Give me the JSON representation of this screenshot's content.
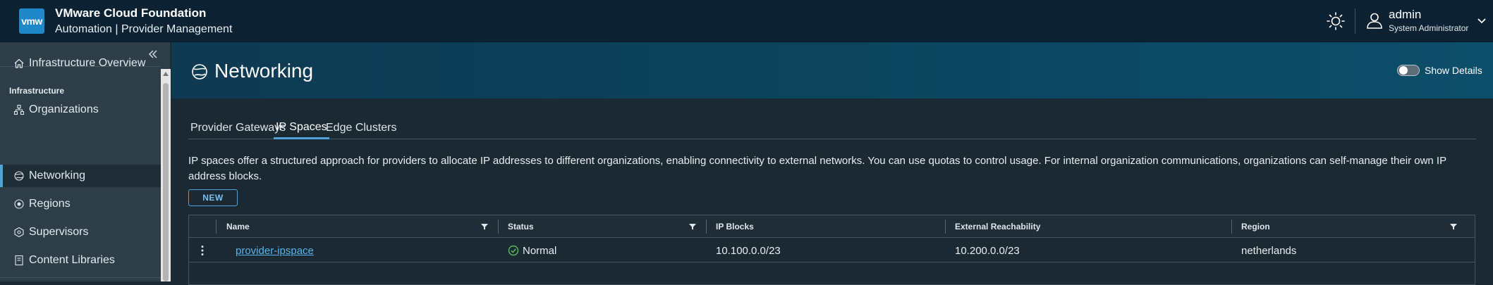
{
  "header": {
    "logo_text": "vmw",
    "app_title": "VMware Cloud Foundation",
    "app_subtitle": "Automation | Provider Management",
    "user_name": "admin",
    "user_role": "System Administrator"
  },
  "sidebar": {
    "items": [
      {
        "label": "Infrastructure Overview",
        "icon": "home-icon"
      },
      {
        "label": "Organizations",
        "icon": "organizations-icon"
      },
      {
        "label": "Networking",
        "icon": "networking-icon",
        "active": true
      },
      {
        "label": "Regions",
        "icon": "regions-icon"
      },
      {
        "label": "Supervisors",
        "icon": "supervisors-icon"
      },
      {
        "label": "Content Libraries",
        "icon": "content-libraries-icon"
      }
    ],
    "section_infrastructure": "Infrastructure"
  },
  "banner": {
    "title": "Networking",
    "show_details_label": "Show Details",
    "show_details_on": false
  },
  "tabs": [
    {
      "label": "Provider Gateways"
    },
    {
      "label": "IP Spaces",
      "active": true
    },
    {
      "label": "Edge Clusters"
    }
  ],
  "description": "IP spaces offer a structured approach for providers to allocate IP addresses to different organizations, enabling connectivity to external networks. You can use quotas to control usage. For internal organization communications, organizations can self-manage their own IP address blocks.",
  "new_button_label": "NEW",
  "table": {
    "columns": [
      "Name",
      "Status",
      "IP Blocks",
      "External Reachability",
      "Region"
    ],
    "rows": [
      {
        "name": "provider-ipspace",
        "status": "Normal",
        "ip_blocks": "10.100.0.0/23",
        "external_reachability": "10.200.0.0/23",
        "region": "netherlands"
      }
    ]
  },
  "colors": {
    "header_bg": "#0c2233",
    "sidebar_bg": "#2d3e48",
    "content_bg": "#1b2a32",
    "accent": "#4fa3d9",
    "link": "#5bb4ec",
    "status_ok": "#5cb85c"
  }
}
